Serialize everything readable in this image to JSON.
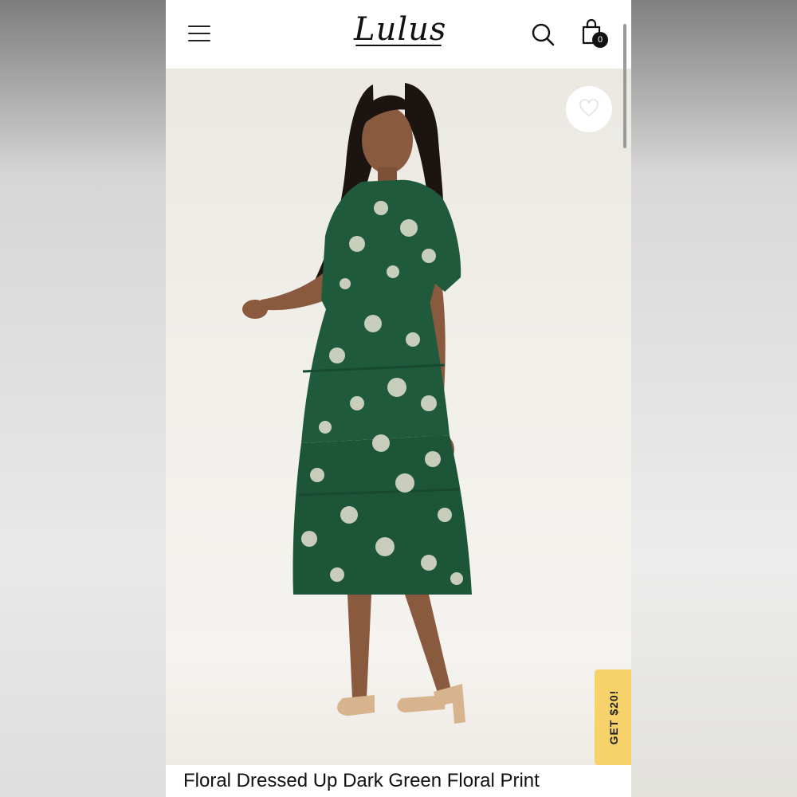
{
  "brand": {
    "logo_text": "Lulus"
  },
  "header": {
    "menu_icon": "hamburger-menu-icon",
    "search_icon": "search-icon",
    "bag_icon": "shopping-bag-icon",
    "bag_count": "0"
  },
  "product": {
    "image_description_icon": "product-photo",
    "wishlist_icon": "heart-icon",
    "title": "Floral Dressed Up Dark Green Floral Print"
  },
  "promo": {
    "label": "GET $20!"
  },
  "colors": {
    "promo_bg": "#f7d26a",
    "dress_green": "#1f5a3c",
    "background": "#f1efea"
  }
}
